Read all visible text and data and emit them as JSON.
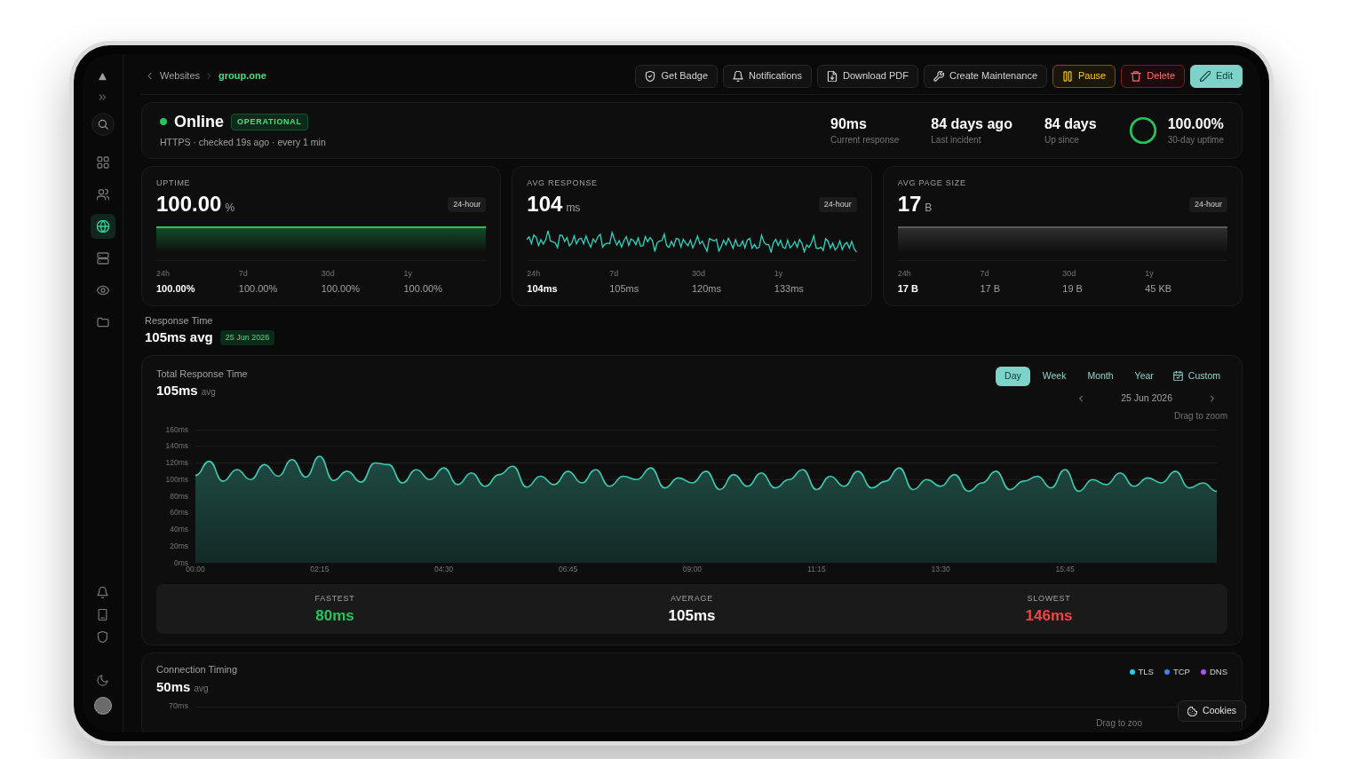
{
  "nav": [
    {
      "selected": false
    },
    {
      "selected": false
    },
    {
      "selected": true
    },
    {
      "selected": false
    },
    {
      "selected": false
    },
    {
      "selected": false
    }
  ],
  "breadcrumb": [
    {
      "label": "Websites",
      "selected": false
    },
    {
      "label": "group.one",
      "selected": true
    }
  ],
  "actions": [
    {
      "label": "Get Badge",
      "kind": "outline"
    },
    {
      "label": "Notifications",
      "kind": "outline"
    },
    {
      "label": "Download PDF",
      "kind": "outline"
    },
    {
      "label": "Create Maintenance",
      "kind": "outline"
    },
    {
      "label": "Pause",
      "kind": "warning"
    },
    {
      "label": "Delete",
      "kind": "danger"
    },
    {
      "label": "Edit",
      "kind": "primary"
    }
  ],
  "status": {
    "state": "Online",
    "badge": "OPERATIONAL",
    "details": "HTTPS · checked 19s ago · every 1 min",
    "stats": [
      {
        "value": "90ms",
        "label": "Current response"
      },
      {
        "value": "84 days ago",
        "label": "Last incident"
      },
      {
        "value": "84 days",
        "label": "Up since"
      }
    ],
    "ring": {
      "level": 1,
      "value": "100.00%",
      "label": "30-day uptime"
    }
  },
  "metrics": [
    {
      "kind": "uptime",
      "title": "UPTIME",
      "value": "100.00",
      "unit": "%",
      "range": "24-hour",
      "periods": [
        {
          "period": "24h",
          "value": "100.00%",
          "selected": true
        },
        {
          "period": "7d",
          "value": "100.00%",
          "selected": false
        },
        {
          "period": "30d",
          "value": "100.00%",
          "selected": false
        },
        {
          "period": "1y",
          "value": "100.00%",
          "selected": false
        }
      ]
    },
    {
      "kind": "response",
      "title": "AVG RESPONSE",
      "value": "104",
      "unit": "ms",
      "range": "24-hour",
      "periods": [
        {
          "period": "24h",
          "value": "104ms",
          "selected": true
        },
        {
          "period": "7d",
          "value": "105ms",
          "selected": false
        },
        {
          "period": "30d",
          "value": "120ms",
          "selected": false
        },
        {
          "period": "1y",
          "value": "133ms",
          "selected": false
        }
      ]
    },
    {
      "kind": "size",
      "title": "AVG PAGE SIZE",
      "value": "17",
      "unit": "B",
      "range": "24-hour",
      "periods": [
        {
          "period": "24h",
          "value": "17 B",
          "selected": true
        },
        {
          "period": "7d",
          "value": "17 B",
          "selected": false
        },
        {
          "period": "30d",
          "value": "19 B",
          "selected": false
        },
        {
          "period": "1y",
          "value": "45 KB",
          "selected": false
        }
      ]
    }
  ],
  "response_time": {
    "title": "Response Time",
    "value": "105ms avg",
    "date": "25 Jun 2026"
  },
  "total_response": {
    "title": "Total Response Time",
    "value": "105ms",
    "suffix": "avg",
    "ranges": [
      {
        "label": "Day",
        "selected": true
      },
      {
        "label": "Week",
        "selected": false
      },
      {
        "label": "Month",
        "selected": false
      },
      {
        "label": "Year",
        "selected": false
      }
    ],
    "custom_range": {
      "label": "Custom"
    },
    "date": "25 Jun 2026",
    "hint": "Drag to zoom",
    "chart_data": {
      "type": "area",
      "x": [
        0,
        15,
        30,
        45,
        60,
        75,
        90,
        105,
        120,
        135,
        150,
        165,
        180,
        195,
        210,
        225,
        240,
        255,
        270,
        285,
        300,
        315,
        330,
        345,
        360,
        375,
        390,
        405,
        420,
        435,
        450,
        465,
        480,
        495,
        510,
        525,
        540,
        555,
        570,
        585,
        600,
        615,
        630,
        645,
        660,
        675,
        690,
        705,
        720,
        735,
        750,
        765,
        780,
        795,
        810,
        825,
        840,
        855,
        870,
        885,
        900,
        915,
        930,
        945,
        960,
        975,
        990,
        1005,
        1020,
        1035,
        1050,
        1065,
        1080,
        1095,
        1110
      ],
      "values": [
        105,
        122,
        98,
        112,
        100,
        118,
        104,
        124,
        103,
        128,
        99,
        110,
        97,
        120,
        118,
        96,
        112,
        100,
        114,
        94,
        108,
        92,
        106,
        116,
        91,
        104,
        94,
        110,
        96,
        112,
        92,
        104,
        100,
        114,
        90,
        102,
        96,
        110,
        88,
        106,
        92,
        108,
        90,
        100,
        112,
        88,
        104,
        92,
        110,
        90,
        98,
        114,
        88,
        100,
        92,
        106,
        86,
        96,
        110,
        88,
        98,
        104,
        90,
        112,
        86,
        100,
        94,
        108,
        92,
        102,
        96,
        110,
        90,
        96,
        86
      ],
      "xlim": [
        0,
        1110
      ],
      "ylim": [
        0,
        160
      ],
      "grid": true,
      "xticks": [
        {
          "value": 0,
          "label": "00:00"
        },
        {
          "value": 135,
          "label": "02:15"
        },
        {
          "value": 270,
          "label": "04:30"
        },
        {
          "value": 405,
          "label": "06:45"
        },
        {
          "value": 540,
          "label": "09:00"
        },
        {
          "value": 675,
          "label": "11:15"
        },
        {
          "value": 810,
          "label": "13:30"
        },
        {
          "value": 945,
          "label": "15:45"
        }
      ],
      "yticks": [
        {
          "value": 0,
          "label": "0ms"
        },
        {
          "value": 20,
          "label": "20ms"
        },
        {
          "value": 40,
          "label": "40ms"
        },
        {
          "value": 60,
          "label": "60ms"
        },
        {
          "value": 80,
          "label": "80ms"
        },
        {
          "value": 100,
          "label": "100ms"
        },
        {
          "value": 120,
          "label": "120ms"
        },
        {
          "value": 140,
          "label": "140ms"
        },
        {
          "value": 160,
          "label": "160ms"
        }
      ]
    },
    "summary": [
      {
        "label": "FASTEST",
        "value": "80ms",
        "color": "#22c55e"
      },
      {
        "label": "AVERAGE",
        "value": "105ms",
        "color": "#ffffff"
      },
      {
        "label": "SLOWEST",
        "value": "146ms",
        "color": "#ef4444"
      }
    ]
  },
  "connection_timing": {
    "title": "Connection Timing",
    "value": "50ms",
    "suffix": "avg",
    "ytick": "70ms",
    "legend": [
      {
        "label": "TLS",
        "color": "#22d3ee"
      },
      {
        "label": "TCP",
        "color": "#3b82f6"
      },
      {
        "label": "DNS",
        "color": "#a855f7"
      }
    ],
    "hint": "Drag to zoo"
  },
  "cookies": {
    "label": "Cookies"
  }
}
